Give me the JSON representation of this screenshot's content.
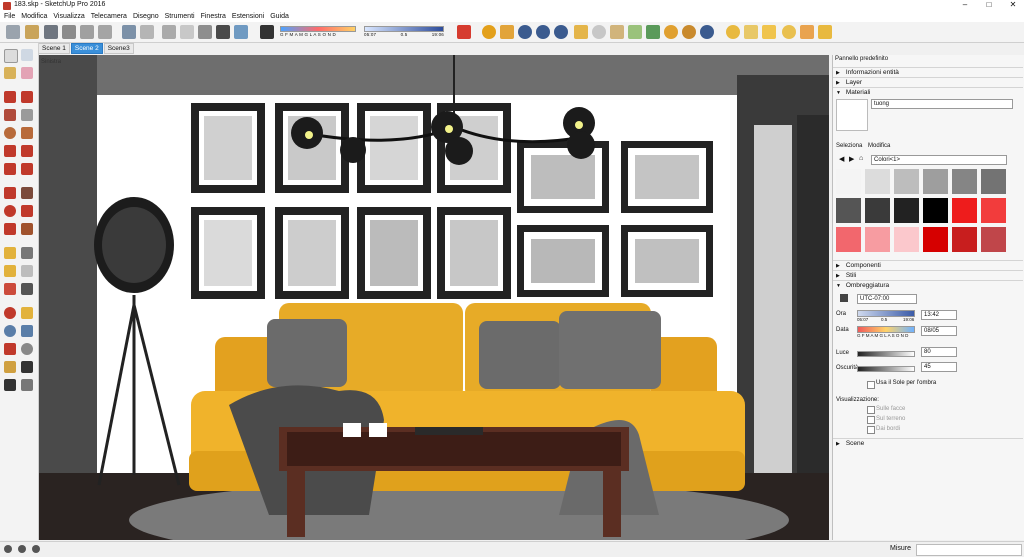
{
  "window": {
    "title": "183.skp - SketchUp Pro 2016"
  },
  "menu": [
    "File",
    "Modifica",
    "Visualizza",
    "Telecamera",
    "Disegno",
    "Strumenti",
    "Finestra",
    "Estensioni",
    "Guida"
  ],
  "shadow_bar": {
    "months": "G F M A M G L A S O N D",
    "time_start": "05:07",
    "time_mid": "0.5",
    "time_end": "19:06"
  },
  "scenes": [
    "Scene 1",
    "Scene 2",
    "Scene3"
  ],
  "active_scene": "Scene 2",
  "viewport": {
    "label": "Sinistra"
  },
  "panel": {
    "title": "Pannello predefinito",
    "sections": {
      "entity_info": "Informazioni entità",
      "layer": "Layer",
      "materials": "Materiali",
      "components": "Componenti",
      "styles": "Stili",
      "shadows": "Ombreggiatura",
      "scenes": "Scene"
    },
    "materials": {
      "name": "tuong",
      "tab_select": "Seleziona",
      "tab_edit": "Modifica",
      "library": "Colori<1>",
      "swatch_colors": [
        "#f4f4f4",
        "#dcdcdc",
        "#bdbdbd",
        "#9e9e9e",
        "#858585",
        "#737373",
        "#555555",
        "#3a3a3a",
        "#222222",
        "#000000",
        "#ee1c1c",
        "#f23c3c",
        "#f2676d",
        "#f79ca1",
        "#fbc8cc",
        "#d60000",
        "#c81e1e",
        "#c0464a"
      ]
    },
    "shadows": {
      "timezone": "UTC-07:00",
      "time_label": "Ora",
      "time_start": "05:07",
      "time_mid": "0.5",
      "time_end": "19:06",
      "time_value": "13:42",
      "date_label": "Data",
      "months": "G F M A M G L A S O N D",
      "date_value": "08/05",
      "light_label": "Luce",
      "light_value": "80",
      "dark_label": "Oscurità",
      "dark_value": "45",
      "use_sun": "Usa il Sole per l'ombra",
      "display_label": "Visualizzazione:",
      "on_faces": "Sulle facce",
      "on_ground": "Sul terreno",
      "from_edges": "Dai bordi"
    }
  },
  "status": {
    "measure_label": "Misure"
  }
}
